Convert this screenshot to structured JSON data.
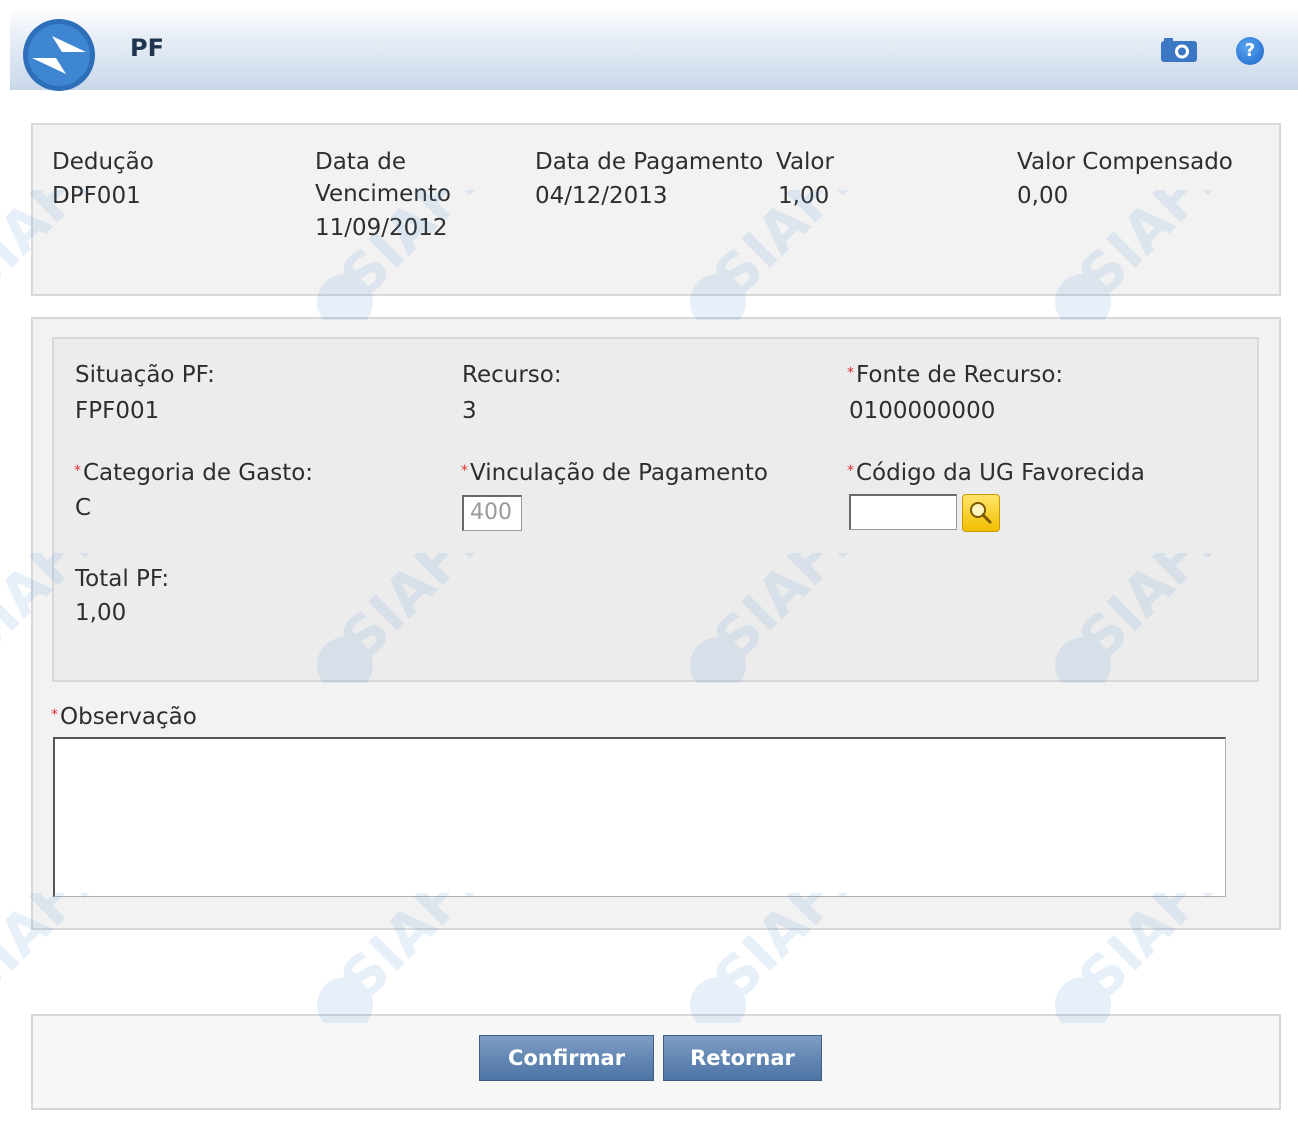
{
  "header": {
    "title": "PF",
    "screenshot_icon": "camera-icon",
    "help_icon": "?"
  },
  "summary": {
    "deducao_label": "Dedução",
    "deducao_value": "DPF001",
    "vencimento_label_line1": "Data de",
    "vencimento_label_line2": "Vencimento",
    "vencimento_value": "11/09/2012",
    "pagamento_label": "Data de Pagamento",
    "pagamento_value": "04/12/2013",
    "valor_label": "Valor",
    "valor_value": "1,00",
    "compensado_label": "Valor Compensado",
    "compensado_value": "0,00"
  },
  "form": {
    "situacao_label": "Situação PF:",
    "situacao_value": "FPF001",
    "recurso_label": "Recurso:",
    "recurso_value": "3",
    "fonte_label": "Fonte de Recurso:",
    "fonte_value": "0100000000",
    "categoria_label": "Categoria de Gasto:",
    "categoria_value": "C",
    "vinculacao_label": "Vinculação de Pagamento",
    "vinculacao_value": "400",
    "ug_label": "Código da UG Favorecida",
    "ug_value": "",
    "total_label": "Total PF:",
    "total_value": "1,00",
    "observacao_label": "Observação",
    "observacao_value": "",
    "required_marker": "*"
  },
  "buttons": {
    "confirmar": "Confirmar",
    "retornar": "Retornar"
  },
  "watermark": {
    "text": "SIAFI",
    "color": "#4f90d8"
  },
  "colors": {
    "required": "#e03030",
    "button": "#5a80b0",
    "search_button": "#f5c400"
  }
}
